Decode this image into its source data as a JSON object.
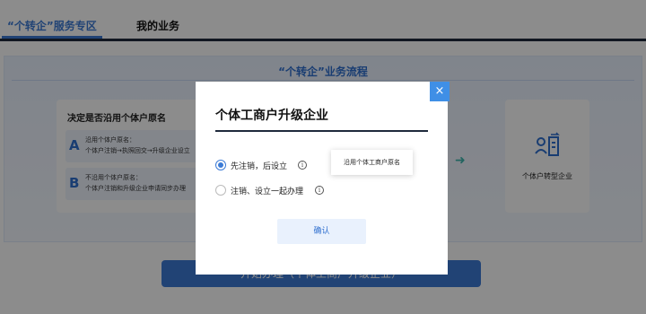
{
  "tabs": [
    {
      "label": "“个转企”服务专区",
      "active": true
    },
    {
      "label": "我的业务",
      "active": false
    }
  ],
  "flow": {
    "title": "“个转企”业务流程",
    "decide_card": {
      "title": "决定是否沿用个体户原名",
      "options": [
        {
          "letter": "A",
          "line1": "沿用个体户原名：",
          "line2": "个体户注销→执照回交→升级企业设立"
        },
        {
          "letter": "B",
          "line1": "不沿用个体户原名：",
          "line2": "个体户注销和升级企业申请同步办理"
        }
      ]
    },
    "target_card": {
      "label": "个体户转型企业",
      "icon": "person-building-icon"
    }
  },
  "start_button": "开始办理（个体工商户升级企业）",
  "modal": {
    "title": "个体工商户升级企业",
    "close_icon": "×",
    "options": [
      {
        "label": "先注销，后设立",
        "checked": true,
        "tooltip": "沿用个体工商户原名"
      },
      {
        "label": "注销、设立一起办理",
        "checked": false
      }
    ],
    "confirm_label": "确认"
  },
  "colors": {
    "accent": "#3c7bd6",
    "overlay": "rgba(0,0,0,0.45)"
  }
}
